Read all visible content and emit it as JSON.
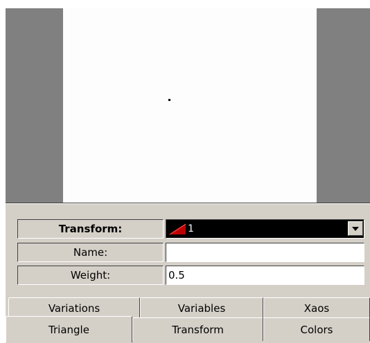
{
  "transform_panel": {
    "transform": {
      "label": "Transform:",
      "value": "1"
    },
    "name": {
      "label": "Name:",
      "value": ""
    },
    "weight": {
      "label": "Weight:",
      "value": "0.5"
    }
  },
  "tabs": {
    "row_back": [
      "Variations",
      "Variables",
      "Xaos"
    ],
    "row_front": [
      "Triangle",
      "Transform",
      "Colors"
    ],
    "active": "Triangle"
  },
  "colors": {
    "panel": "#d4d0c8",
    "preview_border": "#808080",
    "triangle_icon": "#c00000"
  },
  "icons": {
    "transform_icon": "red-triangle-icon",
    "dropdown_icon": "chevron-down-icon"
  }
}
